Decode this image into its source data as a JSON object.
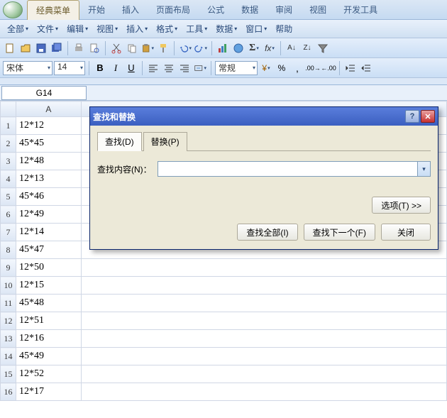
{
  "ribbon": {
    "tabs": [
      "经典菜单",
      "开始",
      "插入",
      "页面布局",
      "公式",
      "数据",
      "审阅",
      "视图",
      "开发工具"
    ],
    "active": 0
  },
  "classic_menu": {
    "items": [
      "全部",
      "文件",
      "编辑",
      "视图",
      "插入",
      "格式",
      "工具",
      "数据",
      "窗口",
      "帮助"
    ]
  },
  "format_bar": {
    "font_name": "宋体",
    "font_size": "14",
    "number_format": "常规"
  },
  "namebox": "G14",
  "grid": {
    "columns": [
      "A"
    ],
    "rows": [
      {
        "n": 1,
        "A": "12*12"
      },
      {
        "n": 2,
        "A": "45*45"
      },
      {
        "n": 3,
        "A": "12*48"
      },
      {
        "n": 4,
        "A": "12*13"
      },
      {
        "n": 5,
        "A": "45*46"
      },
      {
        "n": 6,
        "A": "12*49"
      },
      {
        "n": 7,
        "A": "12*14"
      },
      {
        "n": 8,
        "A": "45*47"
      },
      {
        "n": 9,
        "A": "12*50"
      },
      {
        "n": 10,
        "A": "12*15"
      },
      {
        "n": 11,
        "A": "45*48"
      },
      {
        "n": 12,
        "A": "12*51"
      },
      {
        "n": 13,
        "A": "12*16"
      },
      {
        "n": 14,
        "A": "45*49"
      },
      {
        "n": 15,
        "A": "12*52"
      },
      {
        "n": 16,
        "A": "12*17"
      }
    ]
  },
  "dialog": {
    "title": "查找和替换",
    "tabs": {
      "find": "查找(D)",
      "replace": "替换(P)"
    },
    "active_tab": "find",
    "find_label": "查找内容(N)：",
    "find_value": "",
    "options_btn": "选项(T) >>",
    "find_all_btn": "查找全部(I)",
    "find_next_btn": "查找下一个(F)",
    "close_btn": "关闭"
  }
}
